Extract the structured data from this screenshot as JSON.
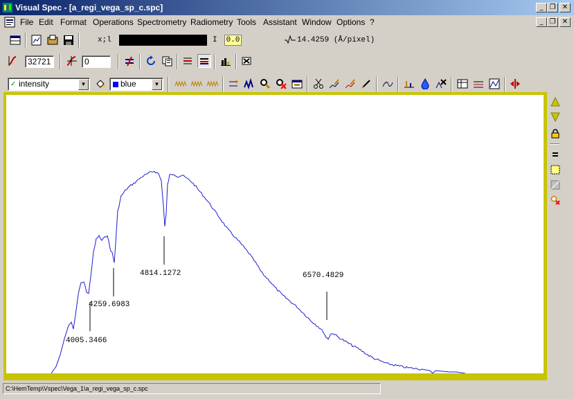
{
  "window": {
    "title": "Visual Spec - [a_regi_vega_sp_c.spc]",
    "min": "_",
    "restore": "❐",
    "close": "✕"
  },
  "menu": [
    "File",
    "Edit",
    "Format",
    "Operations",
    "Spectrometry",
    "Radiometry",
    "Tools",
    "Assistant",
    "Window",
    "Options",
    "?"
  ],
  "toolbar1": {
    "coord_label": "x;l",
    "intensity_label": "I",
    "intensity_value": "0.0",
    "dispersion": "14.4259 (Å/pixel)"
  },
  "toolbar2": {
    "field1": "32721",
    "field2": "0"
  },
  "toolbar3": {
    "profile_select": "intensity",
    "color_select": "blue"
  },
  "colors": {
    "title_start": "#0a246a",
    "title_end": "#a6caf0",
    "spectrum": "#1c1ccc",
    "frame": "#c8c400"
  },
  "chart_data": {
    "type": "line",
    "series": [
      {
        "color": "#1c1ccc"
      }
    ],
    "annotations": [
      {
        "label": "4005.3466"
      },
      {
        "label": "4259.6983"
      },
      {
        "label": "4814.1272"
      },
      {
        "label": "6570.4829"
      }
    ]
  },
  "status": {
    "path": "C:\\HemTemp\\Vspec\\Vega_1\\a_regi_vega_sp_c.spc"
  }
}
